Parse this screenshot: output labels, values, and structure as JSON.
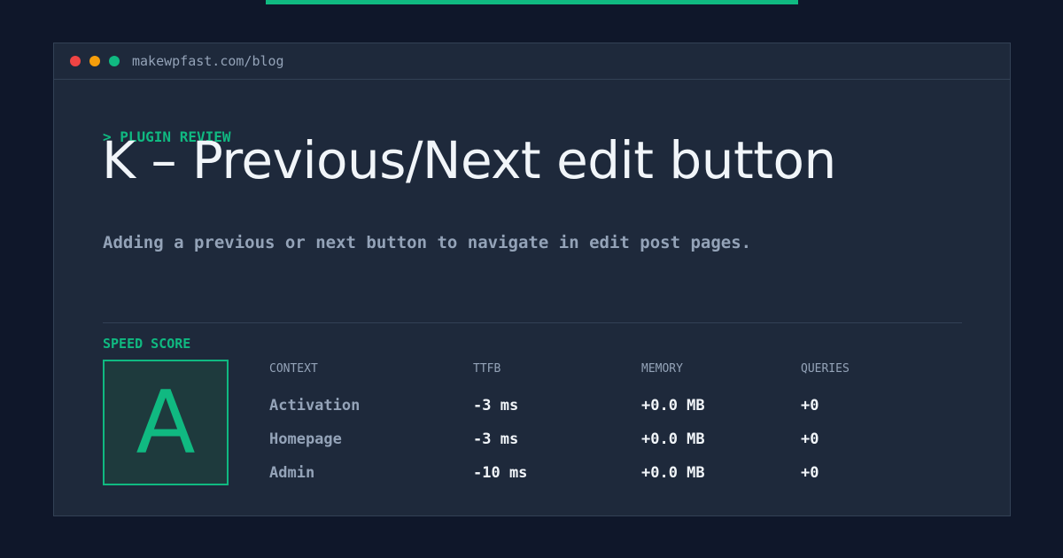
{
  "window": {
    "url": "makewpfast.com/blog"
  },
  "article": {
    "kicker": "> PLUGIN REVIEW",
    "title": "K – Previous/Next edit button",
    "subtitle": "Adding a previous or next button to navigate in edit post pages."
  },
  "score": {
    "label": "SPEED SCORE",
    "grade": "A"
  },
  "metrics": {
    "headers": [
      "CONTEXT",
      "TTFB",
      "MEMORY",
      "QUERIES"
    ],
    "rows": [
      [
        "Activation",
        "-3 ms",
        "+0.0 MB",
        "+0"
      ],
      [
        "Homepage",
        "-3 ms",
        "+0.0 MB",
        "+0"
      ],
      [
        "Admin",
        "-10 ms",
        "+0.0 MB",
        "+0"
      ]
    ]
  },
  "colors": {
    "accent": "#10b981",
    "background": "#0f172a",
    "panel": "#1e293b"
  }
}
